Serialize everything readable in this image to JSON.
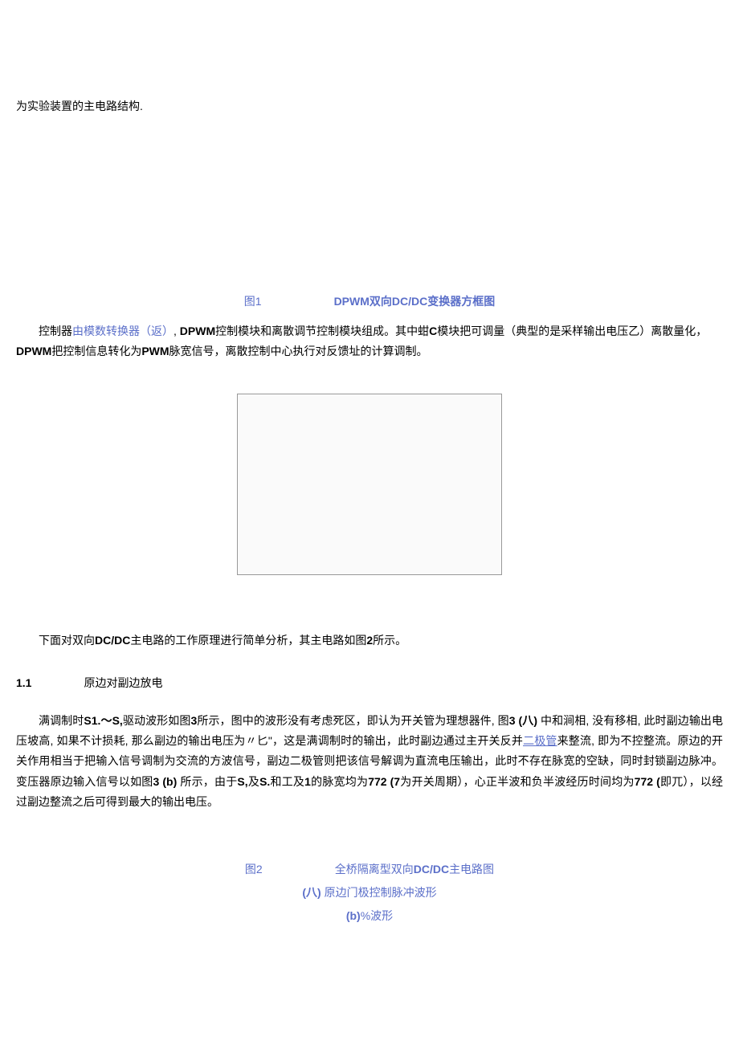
{
  "topText": "为实验装置的主电路结构.",
  "figure1": {
    "prefix": "图1",
    "title_dpwm": "DPWM",
    "title_rest": "双向DC/DC变换器方框图"
  },
  "para1": {
    "t1": "控制器",
    "link1": "由模数转换器（返）",
    "t2": ", ",
    "bold1": "DPWM",
    "t3": "控制模块和离散调节控制模块组成。其中蚶",
    "bold2": "C",
    "t4": "模块把可调量（典型的是采样输出电压乙）离散量化，",
    "bold3": "DPWM",
    "t5": "把控制信息转化为",
    "bold4": "PWM",
    "t6": "脉宽信号，离散控制中心执行对反馈址的计算调制。"
  },
  "para2": {
    "t1": "下面对双向",
    "bold1": "DC/DC",
    "t2": "主电路的工作原理进行简单分析，其主电路如图",
    "bold2": "2",
    "t3": "所示。"
  },
  "section": {
    "num": "1.1",
    "title": "原边对副边放电"
  },
  "para3": {
    "t1": "满调制时",
    "bold1": "S1.〜S,",
    "t2": "驱动波形如图",
    "bold2": "3",
    "t3": "所示，图中的波形没有考虑死区，即认为开关管为理想器件, 图",
    "bold3": "3  (八)",
    "t4": " 中和涧相, 没有移相, 此时副边输出电压坡高, 如果不计损耗, 那么副边的输出电压为〃匕\"，这是满调制时的输出，此时副边通过主开关反并",
    "link1": "二极管",
    "t5": "来整流, 即为不控整流。原边的开关作用相当于把输入信号调制为交流的方波信号，副边二极管则把该信号解调为直流电压输出，此时不存在脉宽的空缺，同时封锁副边脉冲。变压器原边输入信号以如图",
    "bold4": "3  (b)",
    "t6": " 所示，由于",
    "bold5": "S,",
    "t7": "及",
    "bold6": "S.",
    "t8": "和工及",
    "bold7": "1",
    "t9": "的脉宽均为",
    "bold8": "772  (7",
    "t10": "为开关周期），心正半波和负半波经历时间均为",
    "bold9": "772  (",
    "t11": "即兀），以经过副边整流之后可得到最大的输出电压。"
  },
  "figure2": {
    "line1_prefix": "图2",
    "line1_t1": "全桥隔离型双向",
    "line1_bold": "DC/DC",
    "line1_t2": "主电路图",
    "line2_bold": "(八)",
    "line2_t": "  原边门极控制脉冲波形",
    "line3_bold": "(b)",
    "line3_t": "%波形"
  }
}
